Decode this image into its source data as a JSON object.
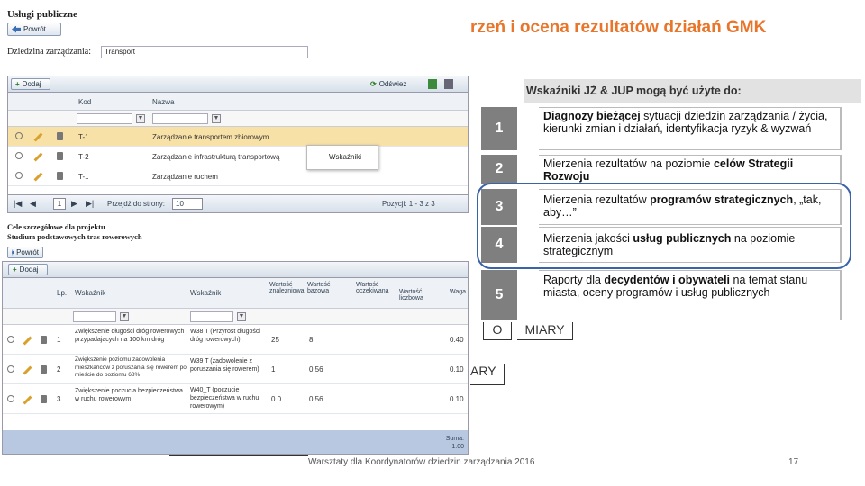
{
  "slide": {
    "title": "rzeń i ocena rezultatów działań GMK",
    "footer": "Warsztaty dla Koordynatorów dziedzin zarządzania 2016",
    "page": "17"
  },
  "app": {
    "title": "Usługi publiczne",
    "back_label": "Powrót",
    "domain_label": "Dziedzina zarządzania:",
    "domain_value": "Transport",
    "add_label": "Dodaj",
    "refresh_label": "Odśwież",
    "grid1": {
      "columns": [
        "Kod",
        "Nazwa"
      ],
      "rows": [
        {
          "code": "T-1",
          "name": "Zarządzanie transportem zbiorowym"
        },
        {
          "code": "T-2",
          "name": "Zarządzanie infrastrukturą transportową"
        },
        {
          "code": "T-..",
          "name": "Zarządzanie ruchem"
        }
      ],
      "pager_text": "Przejdź do strony:",
      "page_value": "1",
      "page_size": "10",
      "records_text": "Pozycji: 1 - 3 z 3"
    },
    "popup_label": "Wskaźniki",
    "proj_label_1": "Cele szczegółowe dla projektu",
    "proj_label_2": "Studium podstawowych tras rowerowych",
    "grid2": {
      "columns": [
        "Lp.",
        "Wskaźnik",
        "Wskaźnik",
        "Wartość znalezniowa",
        "Wartość bazowa",
        "Wartość oczekiwana",
        "Wartość liczbowa",
        "Waga"
      ],
      "rows": [
        {
          "lp": "1",
          "name": "Zwiększenie długości dróg rowerowych przypadających na 100 km dróg",
          "ind": "W38 T (Przyrost długości dróg rowerowych)",
          "v1": "25",
          "v2": "8",
          "w": "0.40"
        },
        {
          "lp": "2",
          "name": "Zwiększenie poziomu zadowolenia mieszkańców z poruszania się rowerem po mieście do poziomu 68%",
          "ind": "W39 T (zadowolenie z poruszania się rowerem)",
          "v1": "1",
          "v2": "0.56",
          "w": "0.10"
        },
        {
          "lp": "3",
          "name": "Zwiększenie poczucia bezpieczeństwa w ruchu rowerowym",
          "ind": "W40_T (poczucie bezpieczeństwa w ruchu rowerowym)",
          "v1": "0.0",
          "v2": "0.56",
          "w": "0.10"
        }
      ],
      "sum_label": "Suma:",
      "sum_value": "1.00"
    }
  },
  "stray": {
    "o": "O",
    "miary": "MIARY",
    "ary": "ARY"
  },
  "panel": {
    "header": "Wskaźniki JŻ & JUP mogą być użyte do:",
    "items": [
      {
        "num": "1",
        "pre": "Diagnozy bieżącej",
        "rest": " sytuacji dziedzin zarządzania / życia, kierunki zmian i działań, identyfikacja ryzyk & wyzwań"
      },
      {
        "num": "2",
        "pre": "Mierzenia rezultatów na poziomie ",
        "bold": "celów Strategii Rozwoju"
      },
      {
        "num": "3",
        "pre": "Mierzenia rezultatów ",
        "bold": "programów strategicznych",
        "post": ", „tak, aby…”"
      },
      {
        "num": "4",
        "pre": "Mierzenia jakości ",
        "bold": "usług publicznych",
        "post": " na poziomie strategicznym"
      },
      {
        "num": "5",
        "pre": "Raporty dla ",
        "bold": "decydentów i obywateli",
        "post": " na temat stanu miasta, oceny programów i usług publicznych"
      }
    ]
  }
}
